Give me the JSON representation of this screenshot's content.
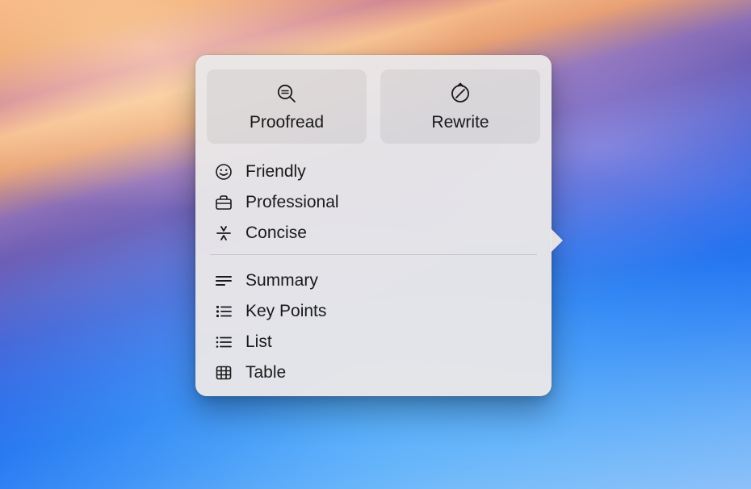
{
  "buttons": {
    "proofread": "Proofread",
    "rewrite": "Rewrite"
  },
  "tone_options": [
    {
      "icon": "smile",
      "label": "Friendly"
    },
    {
      "icon": "briefcase",
      "label": "Professional"
    },
    {
      "icon": "concise",
      "label": "Concise"
    }
  ],
  "format_options": [
    {
      "icon": "summary",
      "label": "Summary"
    },
    {
      "icon": "keypoints",
      "label": "Key Points"
    },
    {
      "icon": "list",
      "label": "List"
    },
    {
      "icon": "table",
      "label": "Table"
    }
  ]
}
